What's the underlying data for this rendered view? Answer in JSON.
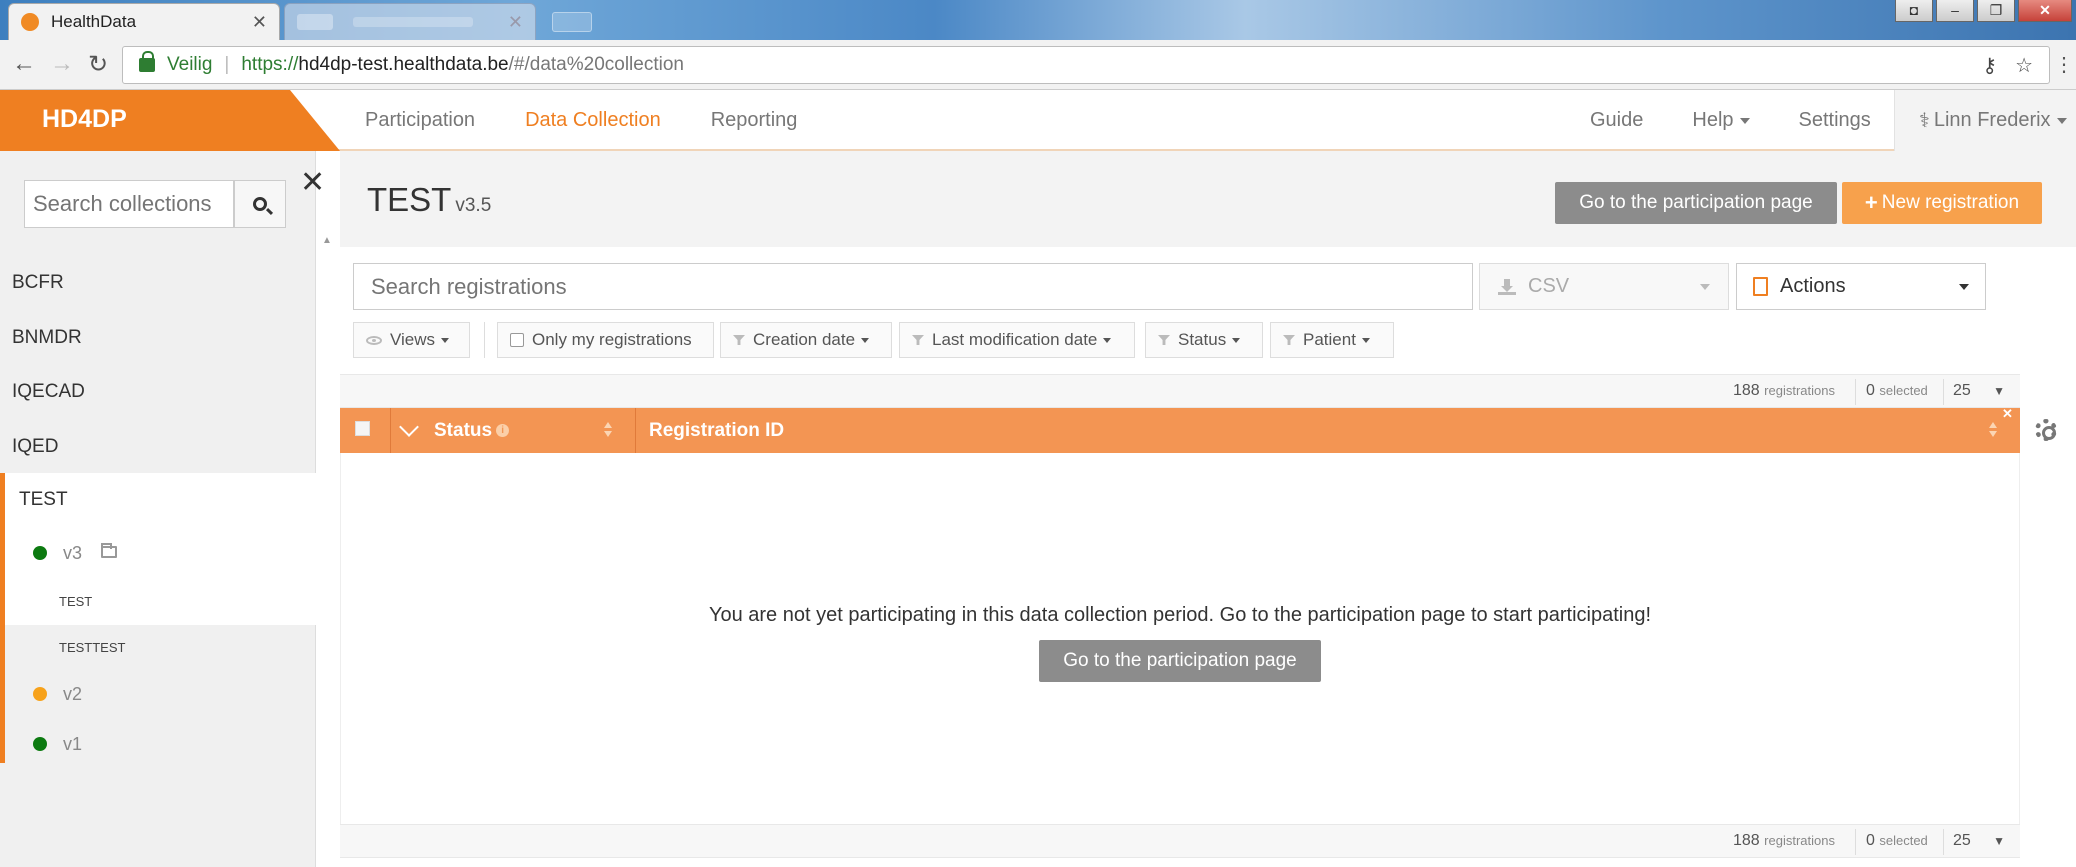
{
  "browser": {
    "tab_title": "HealthData",
    "secure_label": "Veilig",
    "url_scheme": "https://",
    "url_host": "hd4dp-test.healthdata.be",
    "url_path": "/#/data%20collection"
  },
  "header": {
    "brand": "HD4DP",
    "nav": [
      "Participation",
      "Data Collection",
      "Reporting"
    ],
    "active_nav": "Data Collection",
    "guide": "Guide",
    "help": "Help",
    "settings": "Settings",
    "user": "Linn Frederix",
    "accent_color": "#ef7f21"
  },
  "sidebar": {
    "search_placeholder": "Search collections",
    "collections": [
      "BCFR",
      "BNMDR",
      "IQECAD",
      "IQED"
    ],
    "selected": {
      "name": "TEST",
      "versions": [
        {
          "label": "v3",
          "status_color": "#0c7a10",
          "items": [
            "TEST",
            "TESTTEST"
          ]
        },
        {
          "label": "v2",
          "status_color": "#f7a21b"
        },
        {
          "label": "v1",
          "status_color": "#0c7a10"
        }
      ]
    }
  },
  "main": {
    "title": "TEST",
    "version": "v3.5",
    "participation_button": "Go to the participation page",
    "new_registration_button": "New registration",
    "search_placeholder": "Search registrations",
    "csv_label": "CSV",
    "actions_label": "Actions",
    "filters": {
      "views": "Views",
      "only_mine": "Only my registrations",
      "creation_date": "Creation date",
      "last_modification": "Last modification date",
      "status": "Status",
      "patient": "Patient"
    },
    "meta": {
      "count": "188",
      "count_label": "registrations",
      "selected": "0",
      "selected_label": "selected",
      "page_size": "25"
    },
    "columns": [
      "Status",
      "Registration ID"
    ],
    "empty_message": "You are not yet participating in this data collection period. Go to the participation page to start participating!",
    "empty_button": "Go to the participation page"
  }
}
